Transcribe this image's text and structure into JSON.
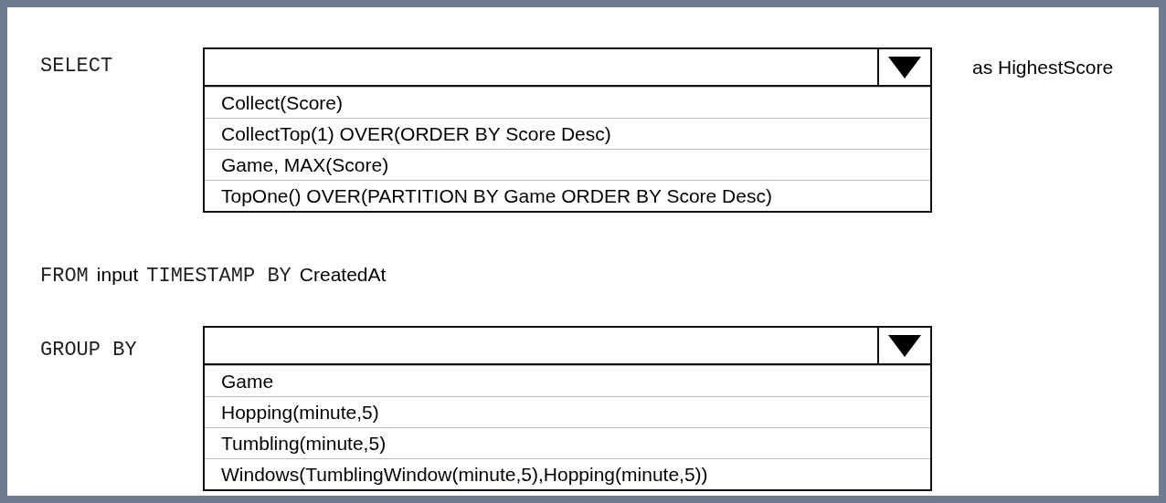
{
  "select_clause": {
    "keyword": "SELECT",
    "dropdown": {
      "options": [
        {
          "label": "Collect(Score)"
        },
        {
          "label": "CollectTop(1) OVER(ORDER BY Score Desc)"
        },
        {
          "label": "Game, MAX(Score)"
        },
        {
          "label": "TopOne() OVER(PARTITION BY Game ORDER BY Score Desc)"
        }
      ]
    },
    "suffix": "as HighestScore"
  },
  "from_clause": {
    "parts": [
      {
        "text": "FROM",
        "kind": "code"
      },
      {
        "text": "input",
        "kind": "plain"
      },
      {
        "text": "TIMESTAMP BY",
        "kind": "code"
      },
      {
        "text": "CreatedAt",
        "kind": "plain"
      }
    ]
  },
  "group_by_clause": {
    "keyword": "GROUP BY",
    "dropdown": {
      "options": [
        {
          "label": "Game"
        },
        {
          "label": "Hopping(minute,5)"
        },
        {
          "label": "Tumbling(minute,5)"
        },
        {
          "label": "Windows(TumblingWindow(minute,5),Hopping(minute,5))"
        }
      ]
    }
  }
}
